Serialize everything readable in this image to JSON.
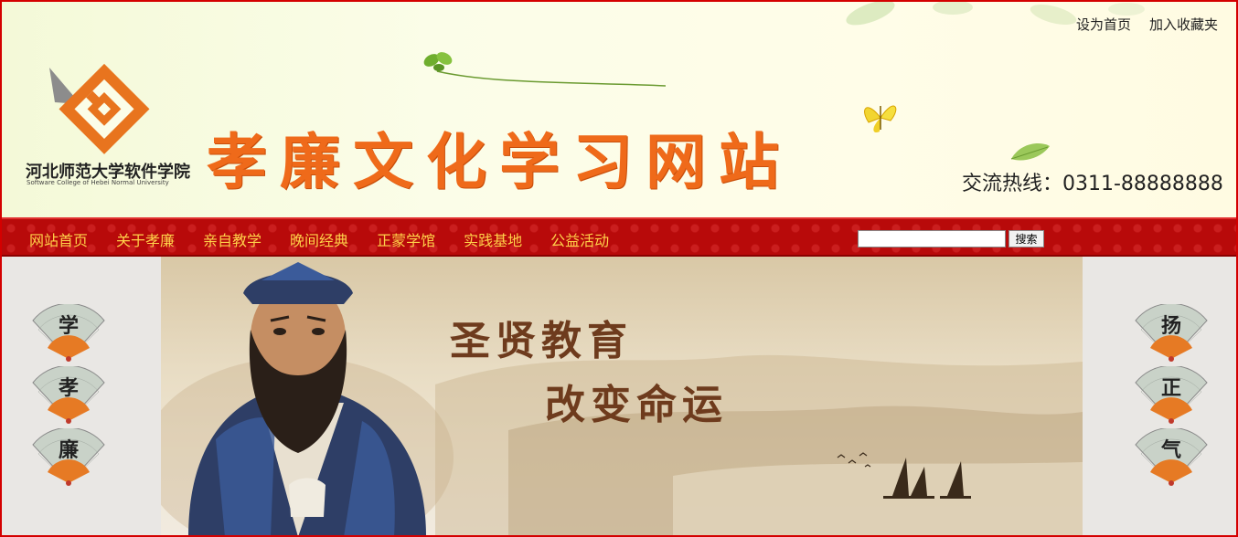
{
  "top_links": {
    "set_home": "设为首页",
    "bookmark": "加入收藏夹"
  },
  "header": {
    "logo_text": "河北师范大学软件学院",
    "logo_sub": "Software College of Hebei Normal University",
    "site_title": "孝廉文化学习网站",
    "hotline": "交流热线：0311-88888888"
  },
  "nav": {
    "items": [
      "网站首页",
      "关于孝廉",
      "亲自教学",
      "晚间经典",
      "正蒙学馆",
      "实践基地",
      "公益活动"
    ],
    "search_placeholder": "",
    "search_button": "搜索"
  },
  "banner": {
    "line1": "圣贤教育",
    "line2": "改变命运"
  },
  "fans": {
    "left": [
      "学",
      "孝",
      "廉"
    ],
    "right": [
      "扬",
      "正",
      "气"
    ]
  },
  "colors": {
    "title_orange": "#ef6a1a",
    "nav_red": "#b80a0a",
    "nav_text": "#ffd24a",
    "banner_text": "#6e3b1d",
    "border_red": "#d40000"
  },
  "icons": [
    "logo-icon",
    "leaf-icon",
    "butterfly-icon",
    "fan-icon",
    "confucius-figure",
    "sailboat-icon"
  ]
}
